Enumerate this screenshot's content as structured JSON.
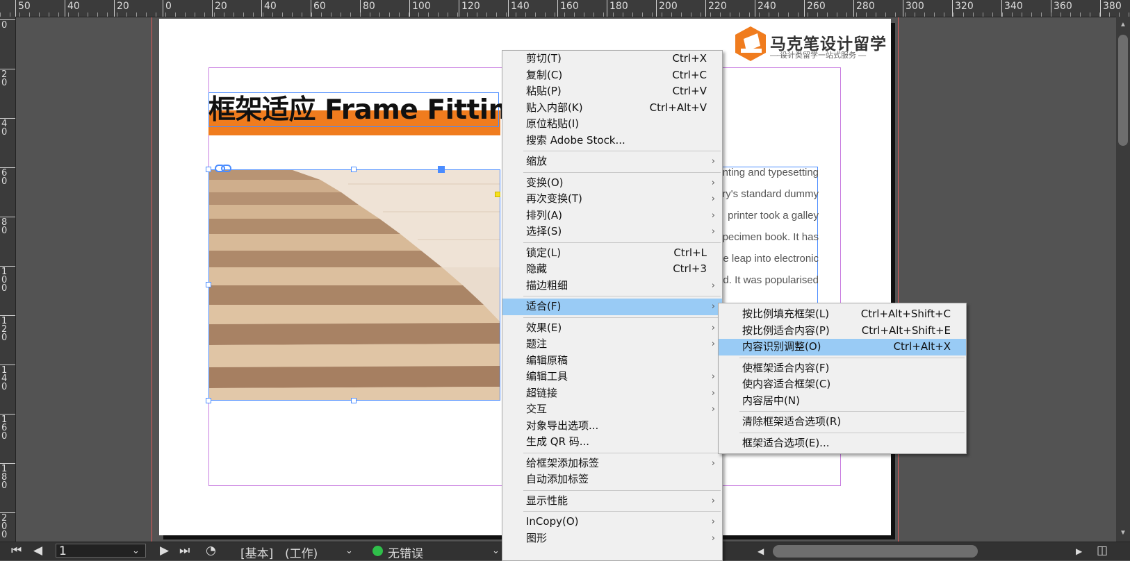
{
  "ruler_top": {
    "labels": [
      "50",
      "40",
      "20",
      "0",
      "20",
      "40",
      "60",
      "80",
      "100",
      "120",
      "140",
      "160",
      "180",
      "200",
      "220",
      "240",
      "260",
      "280",
      "300",
      "320",
      "340",
      "360",
      "380"
    ]
  },
  "ruler_left": {
    "labels": [
      "0",
      "20",
      "40",
      "60",
      "80",
      "100",
      "120",
      "140",
      "160",
      "180",
      "200"
    ]
  },
  "document": {
    "logo_main": "马克笔设计留学",
    "logo_sub": "— 设计类留学一站式服务 —",
    "title": "框架适应 Frame Fitting",
    "body_lines": [
      "nting and typesetting",
      "ry's standard dummy",
      "printer took a galley",
      "pecimen book. It has",
      "e leap into electronic",
      "ed. It was popularised",
      "..."
    ]
  },
  "context_menu": {
    "items": [
      {
        "label": "剪切(T)",
        "shortcut": "Ctrl+X"
      },
      {
        "label": "复制(C)",
        "shortcut": "Ctrl+C"
      },
      {
        "label": "粘贴(P)",
        "shortcut": "Ctrl+V"
      },
      {
        "label": "贴入内部(K)",
        "shortcut": "Ctrl+Alt+V"
      },
      {
        "label": "原位粘贴(I)",
        "shortcut": ""
      },
      {
        "label": "搜索 Adobe Stock...",
        "shortcut": ""
      },
      {
        "label": "缩放",
        "submenu": true
      },
      {
        "label": "变换(O)",
        "submenu": true
      },
      {
        "label": "再次变换(T)",
        "submenu": true
      },
      {
        "label": "排列(A)",
        "submenu": true
      },
      {
        "label": "选择(S)",
        "submenu": true
      },
      {
        "label": "锁定(L)",
        "shortcut": "Ctrl+L"
      },
      {
        "label": "隐藏",
        "shortcut": "Ctrl+3"
      },
      {
        "label": "描边粗细",
        "submenu": true
      },
      {
        "label": "适合(F)",
        "submenu": true,
        "highlighted": true
      },
      {
        "label": "效果(E)",
        "submenu": true
      },
      {
        "label": "题注",
        "submenu": true
      },
      {
        "label": "编辑原稿",
        "shortcut": ""
      },
      {
        "label": "编辑工具",
        "submenu": true
      },
      {
        "label": "超链接",
        "submenu": true
      },
      {
        "label": "交互",
        "submenu": true
      },
      {
        "label": "对象导出选项...",
        "shortcut": ""
      },
      {
        "label": "生成 QR 码...",
        "shortcut": ""
      },
      {
        "label": "给框架添加标签",
        "submenu": true
      },
      {
        "label": "自动添加标签",
        "shortcut": ""
      },
      {
        "label": "显示性能",
        "submenu": true
      },
      {
        "label": "InCopy(O)",
        "submenu": true
      },
      {
        "label": "图形",
        "submenu": true
      }
    ]
  },
  "fit_submenu": {
    "items": [
      {
        "label": "按比例填充框架(L)",
        "shortcut": "Ctrl+Alt+Shift+C"
      },
      {
        "label": "按比例适合内容(P)",
        "shortcut": "Ctrl+Alt+Shift+E"
      },
      {
        "label": "内容识别调整(O)",
        "shortcut": "Ctrl+Alt+X",
        "highlighted": true
      },
      {
        "label": "使框架适合内容(F)",
        "shortcut": ""
      },
      {
        "label": "使内容适合框架(C)",
        "shortcut": ""
      },
      {
        "label": "内容居中(N)",
        "shortcut": ""
      },
      {
        "label": "清除框架适合选项(R)",
        "shortcut": ""
      },
      {
        "label": "框架适合选项(E)...",
        "shortcut": ""
      }
    ]
  },
  "statusbar": {
    "page_number": "1",
    "master": "[基本]",
    "mode": "(工作)",
    "preflight": "无错误"
  },
  "colors": {
    "accent_orange": "#f07c1e",
    "menu_highlight": "#99cbf5",
    "selection_blue": "#4a8cff",
    "preflight_ok": "#2fbf4a"
  }
}
